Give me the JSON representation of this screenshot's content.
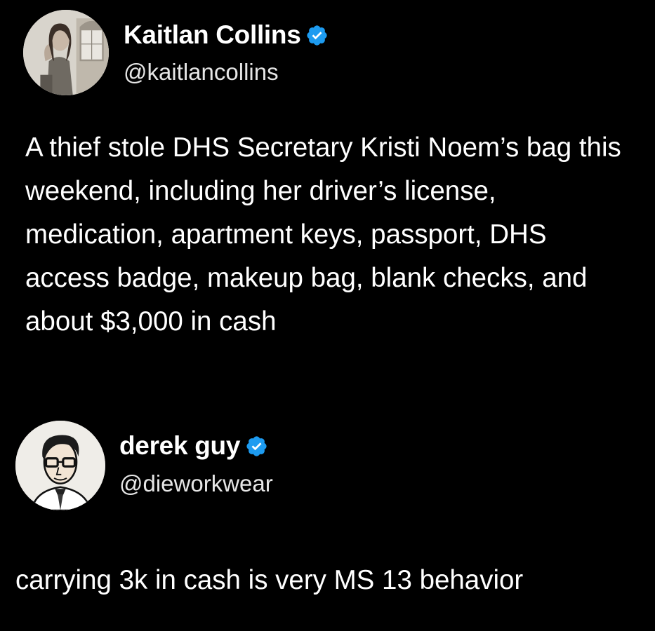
{
  "tweets": [
    {
      "display_name": "Kaitlan Collins",
      "handle": "@kaitlancollins",
      "verified": true,
      "avatar_icon": "profile-photo",
      "text": "A thief stole DHS Secretary Kristi Noem’s bag this weekend, including her driver’s license, medication, apartment keys, passport, DHS access badge, makeup bag, blank checks, and about $3,000 in cash"
    },
    {
      "display_name": "derek guy",
      "handle": "@dieworkwear",
      "verified": true,
      "avatar_icon": "illustrated-portrait",
      "text": "carrying 3k in cash is very MS 13 behavior"
    }
  ],
  "colors": {
    "background": "#000000",
    "text": "#ffffff",
    "verified_badge": "#1d9bf0"
  }
}
